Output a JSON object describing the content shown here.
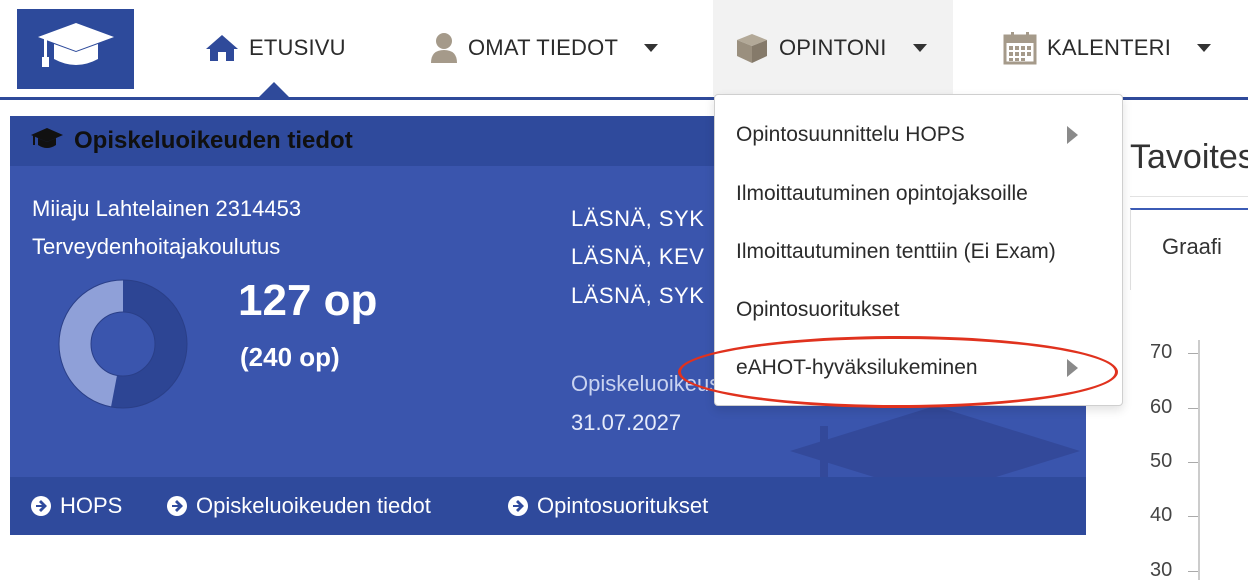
{
  "nav": {
    "logo_icon": "graduation-cap-icon",
    "items": [
      {
        "label": "ETUSIVU",
        "icon": "home-icon",
        "active": true
      },
      {
        "label": "OMAT TIEDOT",
        "icon": "user-icon",
        "has_dropdown": true
      },
      {
        "label": "OPINTONI",
        "icon": "box-icon",
        "has_dropdown": true,
        "open": true
      },
      {
        "label": "KALENTERI",
        "icon": "calendar-icon",
        "has_dropdown": true
      }
    ]
  },
  "card": {
    "title": "Opiskeluoikeuden tiedot",
    "student": "Miiaju Lahtelainen 2314453",
    "program": "Terveydenhoitajakoulutus",
    "credits_done": "127 op",
    "credits_total": "(240 op)",
    "progress_fraction": 0.53,
    "terms": [
      "LÄSNÄ, SYK",
      "LÄSNÄ, KEV",
      "LÄSNÄ, SYK"
    ],
    "validity_label": "Opiskeluoikeus",
    "validity_date": "31.07.2027",
    "footer_links": [
      "HOPS",
      "Opiskeluoikeuden tiedot",
      "Opintosuoritukset"
    ]
  },
  "dropdown": {
    "items": [
      {
        "label": "Opintosuunnittelu HOPS",
        "submenu": true
      },
      {
        "label": "Ilmoittautuminen opintojaksoille",
        "submenu": false
      },
      {
        "label": "Ilmoittautuminen tenttiin (Ei Exam)",
        "submenu": false
      },
      {
        "label": "Opintosuoritukset",
        "submenu": false
      },
      {
        "label": "eAHOT-hyväksilukeminen",
        "submenu": true,
        "highlighted": true
      }
    ]
  },
  "side": {
    "title": "Tavoites",
    "tab": "Graafi",
    "y_ticks": [
      "70",
      "60",
      "50",
      "40",
      "30"
    ]
  },
  "colors": {
    "brand_blue": "#2d4a9b",
    "card_blue": "#3a55ad",
    "highlight_red": "#e0321e"
  }
}
